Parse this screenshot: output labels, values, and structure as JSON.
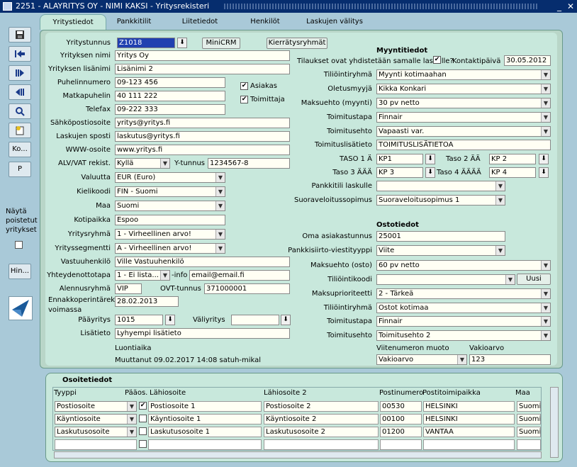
{
  "window": {
    "title": "2251 - ALAYRITYS OY - NIMI KAKSI - Yritysrekisteri",
    "min": "_",
    "close": "✕"
  },
  "sidebar": {
    "ko": "Ko...",
    "p": "P",
    "show_deleted": [
      "Näytä",
      "poistetut",
      "yritykset"
    ],
    "hin": "Hin..."
  },
  "tabs": [
    "Yritystiedot",
    "Pankkitilit",
    "Liitetiedot",
    "Henkilöt",
    "Laskujen välitys"
  ],
  "company": {
    "yritystunnus_label": "Yritystunnus",
    "yritystunnus": "Z1018",
    "minicrm": "MiniCRM",
    "kierratys": "Kierrätysryhmät",
    "nimi_label": "Yrityksen nimi",
    "nimi": "Yritys Oy",
    "lisanimi_label": "Yrityksen lisänimi",
    "lisanimi": "Lisänimi 2",
    "puhelin_label": "Puhelinnumero",
    "puhelin": "09-123 456",
    "matka_label": "Matkapuhelin",
    "matka": "40 111 222",
    "telefax_label": "Telefax",
    "telefax": "09-222 333",
    "asiakas": "Asiakas",
    "toimittaja": "Toimittaja",
    "email_label": "Sähköpostiosoite",
    "email": "yritys@yritys.fi",
    "laskuposti_label": "Laskujen sposti",
    "laskuposti": "laskutus@yritys.fi",
    "www_label": "WWW-osoite",
    "www": "www.yritys.fi",
    "alv_label": "ALV/VAT rekist.",
    "alv": "Kyllä",
    "ytunnus_label": "Y-tunnus",
    "ytunnus": "1234567-8",
    "valuutta_label": "Valuutta",
    "valuutta": "EUR (Euro)",
    "kieli_label": "Kielikoodi",
    "kieli": "FIN - Suomi",
    "maa_label": "Maa",
    "maa": "Suomi",
    "kotipaikka_label": "Kotipaikka",
    "kotipaikka": "Espoo",
    "ryhma_label": "Yritysryhmä",
    "ryhma": "1 - Virheellinen arvo!",
    "segmentti_label": "Yrityssegmentti",
    "segmentti": "A - Virheellinen arvo!",
    "vastuu_label": "Vastuuhenkilö",
    "vastuu": "Ville Vastuuhenkilö",
    "yhteys_label": "Yhteydenottotapa",
    "yhteys": "1 - Ei lista...",
    "info_label": "-info",
    "info": "email@email.fi",
    "alennus_label": "Alennusryhmä",
    "alennus": "VIP",
    "ovt_label": "OVT-tunnus",
    "ovt": "371000001",
    "ennakko_label1": "Ennakkoperintärek.",
    "ennakko_label2": "voimassa",
    "ennakko": "28.02.2013",
    "paayritys_label": "Pääyritys",
    "paayritys": "1015",
    "valiyritys_label": "Väliyritys",
    "valiyritys": "",
    "lisatieto_label": "Lisätieto",
    "lisatieto": "Lyhyempi lisätieto",
    "luontiaika": "Luontiaika",
    "muuttanut": "Muuttanut  09.02.2017 14:08   satuh-mikal"
  },
  "sales": {
    "title": "Myyntitiedot",
    "tilaukset_label": "Tilaukset ovat yhdistetään samalle laskulle?",
    "kontakti_label": "Kontaktipäivä",
    "kontakti": "30.05.2012",
    "tiliointi_label": "Tiliöintiryhmä",
    "tiliointi": "Myynti kotimaahan",
    "myyja_label": "Oletusmyyjä",
    "myyja": "Kikka Konkari",
    "maksuehto_label": "Maksuehto (myynti)",
    "maksuehto": "30 pv netto",
    "toimitustapa_label": "Toimitustapa",
    "toimitustapa": "Finnair",
    "toimitusehto_label": "Toimitusehto",
    "toimitusehto": "Vapaasti var.",
    "toimlisa_label": "Toimituslisätieto",
    "toimlisa": "TOIMITUSLISÄTIETOA",
    "taso1_label": "TASO 1 Ä",
    "taso1": "KP1",
    "taso2_label": "Taso 2 ÄÄ",
    "taso2": "KP 2",
    "taso3_label": "Taso 3 ÄÄÄ",
    "taso3": "KP 3",
    "taso4_label": "Taso 4 ÄÄÄÄ",
    "taso4": "KP 4",
    "pankkitili_label": "Pankkitili laskulle",
    "pankkitili": "",
    "suora_label": "Suoraveloitussopimus",
    "suora": "Suoraveloitusopimus 1"
  },
  "purchase": {
    "title": "Ostotiedot",
    "oma_label": "Oma asiakastunnus",
    "oma": "25001",
    "viite_label": "Pankkisiirto-viestityyppi",
    "viite": "Viite",
    "maksuehto_label": "Maksuehto (osto)",
    "maksuehto": "60 pv netto",
    "tilikoodi_label": "Tiliöintikoodi",
    "tilikoodi": "",
    "uusi": "Uusi",
    "prio_label": "Maksuprioriteetti",
    "prio": "2 - Tärkeä",
    "tiliointi_label": "Tiliöintiryhmä",
    "tiliointi": "Ostot kotimaa",
    "toimitustapa_label": "Toimitustapa",
    "toimitustapa": "Finnair",
    "toimitusehto_label": "Toimitusehto",
    "toimitusehto": "Toimitusehto 2",
    "viitemuoto_label": "Viitenumeron muoto",
    "viitemuoto": "Vakioarvo",
    "vakio_label": "Vakioarvo",
    "vakio": "123"
  },
  "addresses": {
    "title": "Osoitetiedot",
    "headers": [
      "Tyyppi",
      "Pääos.",
      "Lähiosoite",
      "Lähiosoite 2",
      "Postinumero",
      "Postitoimipaikka",
      "Maa"
    ],
    "rows": [
      {
        "type": "Postiosoite",
        "main": true,
        "addr1": "Postiosoite 1",
        "addr2": "Postiosoite 2",
        "zip": "00530",
        "city": "HELSINKI",
        "country": "Suomi"
      },
      {
        "type": "Käyntiosoite",
        "main": false,
        "addr1": "Käyntiosoite 1",
        "addr2": "Käyntiosoite 2",
        "zip": "00100",
        "city": "HELSINKI",
        "country": "Suomi"
      },
      {
        "type": "Laskutusosoite",
        "main": false,
        "addr1": "Laskutusosoite 1",
        "addr2": "Laskutusosoite 2",
        "zip": "01200",
        "city": "VANTAA",
        "country": "Suomi"
      }
    ]
  },
  "icons": {
    "save": "save-icon",
    "first": "first-record-icon",
    "next": "next-record-icon",
    "prev": "prev-record-icon",
    "search": "search-icon",
    "new": "new-record-icon",
    "lookup": "lookup-arrow-icon",
    "dropdown": "chevron-down-icon",
    "logo": "app-logo-icon"
  }
}
